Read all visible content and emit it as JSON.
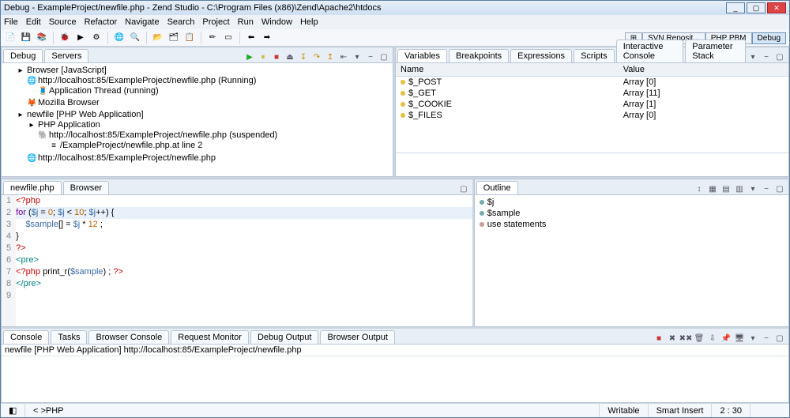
{
  "title": "Debug - ExampleProject/newfile.php - Zend Studio - C:\\Program Files (x86)\\Zend\\Apache2\\htdocs",
  "menu": [
    "File",
    "Edit",
    "Source",
    "Refactor",
    "Navigate",
    "Search",
    "Project",
    "Run",
    "Window",
    "Help"
  ],
  "perspectives": [
    {
      "label": "SVN Reposit..."
    },
    {
      "label": "PHP PBM"
    },
    {
      "label": "Debug",
      "active": true
    }
  ],
  "debug_view": {
    "tabs": [
      {
        "label": "Debug",
        "active": true
      },
      {
        "label": "Servers"
      }
    ],
    "tree": [
      {
        "label": "Browser [JavaScript]",
        "icon": "▸",
        "children": [
          {
            "label": "http://localhost:85/ExampleProject/newfile.php (Running)",
            "icon": "🌐",
            "children": [
              {
                "label": "Application Thread (running)",
                "icon": "🧵"
              }
            ]
          },
          {
            "label": "Mozilla Browser",
            "icon": "🦊"
          }
        ]
      },
      {
        "label": "newfile [PHP Web Application]",
        "icon": "▸",
        "children": [
          {
            "label": "PHP Application",
            "icon": "▸",
            "children": [
              {
                "label": "http://localhost:85/ExampleProject/newfile.php (suspended)",
                "icon": "🐘",
                "children": [
                  {
                    "label": "/ExampleProject/newfile.php.at line 2",
                    "icon": "≡"
                  }
                ]
              }
            ]
          },
          {
            "label": "http://localhost:85/ExampleProject/newfile.php",
            "icon": "🌐"
          }
        ]
      }
    ]
  },
  "variables_view": {
    "tabs": [
      {
        "label": "Variables",
        "active": true
      },
      {
        "label": "Breakpoints"
      },
      {
        "label": "Expressions"
      },
      {
        "label": "Scripts"
      },
      {
        "label": "Interactive Console"
      },
      {
        "label": "Parameter Stack"
      }
    ],
    "columns": [
      "Name",
      "Value"
    ],
    "rows": [
      {
        "name": "$_POST",
        "value": "Array [0]"
      },
      {
        "name": "$_GET",
        "value": "Array [11]"
      },
      {
        "name": "$_COOKIE",
        "value": "Array [1]"
      },
      {
        "name": "$_FILES",
        "value": "Array [0]"
      }
    ]
  },
  "editor": {
    "tabs": [
      {
        "label": "newfile.php",
        "active": true
      },
      {
        "label": "Browser"
      }
    ],
    "lines": [
      {
        "n": 1,
        "html": "<span class='kw-php'>&lt;?php</span>"
      },
      {
        "n": 2,
        "hl": true,
        "html": "<span class='kw-ctrl'>for</span> (<span class='kw-var'>$j</span> = <span class='kw-num'>0</span>; <span class='kw-var'>$j</span> &lt; <span class='kw-num'>10</span>; <span class='kw-var'>$j</span>++) {"
      },
      {
        "n": 3,
        "html": "    <span class='kw-var'>$sample</span>[] = <span class='kw-var'>$j</span> * <span class='kw-num'>12</span> ;"
      },
      {
        "n": 4,
        "html": "}"
      },
      {
        "n": 5,
        "html": "<span class='kw-php'>?&gt;</span>"
      },
      {
        "n": 6,
        "html": "<span class='kw-tag'>&lt;pre&gt;</span>"
      },
      {
        "n": 7,
        "html": "<span class='kw-php'>&lt;?php</span> print_r(<span class='kw-var'>$sample</span>) ; <span class='kw-php'>?&gt;</span>"
      },
      {
        "n": 8,
        "html": "<span class='kw-tag'>&lt;/pre&gt;</span>"
      },
      {
        "n": 9,
        "html": ""
      }
    ]
  },
  "outline": {
    "tab": "Outline",
    "items": [
      {
        "icon": "○",
        "color": "#7aa",
        "label": "$j"
      },
      {
        "icon": "○",
        "color": "#7aa",
        "label": "$sample"
      },
      {
        "icon": "○",
        "color": "#c99",
        "label": "use statements"
      }
    ]
  },
  "console_view": {
    "tabs": [
      {
        "label": "Console",
        "active": true
      },
      {
        "label": "Tasks"
      },
      {
        "label": "Browser Console"
      },
      {
        "label": "Request Monitor"
      },
      {
        "label": "Debug Output"
      },
      {
        "label": "Browser Output"
      }
    ],
    "status": "newfile [PHP Web Application] http://localhost:85/ExampleProject/newfile.php"
  },
  "footer": {
    "context": "PHP",
    "writable": "Writable",
    "insert": "Smart Insert",
    "pos": "2 : 30"
  }
}
